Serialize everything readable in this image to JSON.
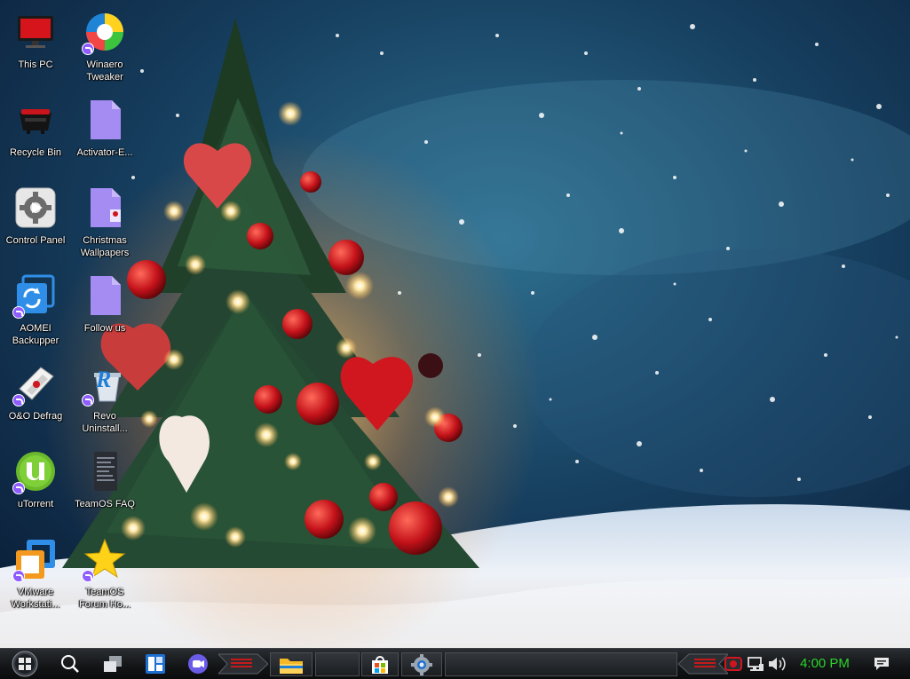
{
  "desktop": {
    "icons": [
      {
        "name": "this-pc",
        "label": "This PC",
        "icon": "monitor-icon",
        "shortcut": false
      },
      {
        "name": "winaero-tweaker",
        "label": "Winaero\nTweaker",
        "icon": "winaero-icon",
        "shortcut": true
      },
      {
        "name": "recycle-bin",
        "label": "Recycle Bin",
        "icon": "recycle-bin-icon",
        "shortcut": false
      },
      {
        "name": "activator",
        "label": "Activator-E...",
        "icon": "file-icon",
        "shortcut": false
      },
      {
        "name": "control-panel",
        "label": "Control Panel",
        "icon": "gear-icon",
        "shortcut": false
      },
      {
        "name": "christmas-wallpapers",
        "label": "Christmas\nWallpapers",
        "icon": "file-icon",
        "shortcut": false
      },
      {
        "name": "aomei-backupper",
        "label": "AOMEI\nBackupper",
        "icon": "backup-icon",
        "shortcut": true
      },
      {
        "name": "follow-us",
        "label": "Follow us",
        "icon": "file-icon",
        "shortcut": false
      },
      {
        "name": "oo-defrag",
        "label": "O&O Defrag",
        "icon": "defrag-icon",
        "shortcut": true
      },
      {
        "name": "revo-uninstaller",
        "label": "Revo\nUninstall...",
        "icon": "revo-icon",
        "shortcut": true
      },
      {
        "name": "utorrent",
        "label": "uTorrent",
        "icon": "utorrent-icon",
        "shortcut": true
      },
      {
        "name": "teamos-faq",
        "label": "TeamOS FAQ",
        "icon": "document-icon",
        "shortcut": false
      },
      {
        "name": "vmware-workstation",
        "label": "VMware\nWorkstati...",
        "icon": "vmware-icon",
        "shortcut": true
      },
      {
        "name": "teamos-forum",
        "label": "TeamOS\nForum Ho...",
        "icon": "star-icon",
        "shortcut": true
      }
    ]
  },
  "taskbar": {
    "start_icon": "windows-orb-icon",
    "search_icon": "search-icon",
    "task_view_icon": "task-view-icon",
    "widgets_icon": "widgets-icon",
    "chat_icon": "chat-icon",
    "pinned": [
      {
        "name": "file-explorer",
        "icon": "folder-icon"
      },
      {
        "name": "microsoft-store",
        "icon": "store-icon"
      },
      {
        "name": "settings",
        "icon": "settings-gear-icon"
      }
    ],
    "tray": {
      "icons": [
        "record-icon",
        "network-icon",
        "volume-icon"
      ],
      "clock": "4:00 PM",
      "notification_icon": "notification-icon"
    }
  },
  "colors": {
    "clock_text": "#2bd42b",
    "shortcut_badge": "#8e5cff",
    "taskbar_bg": "#121416"
  }
}
